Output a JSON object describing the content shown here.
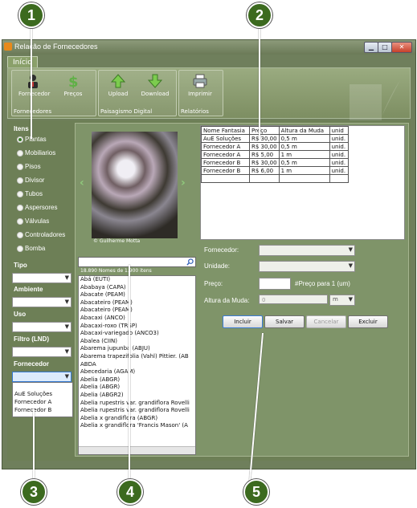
{
  "window": {
    "title": "Relação de Fornecedores",
    "minimize": "▁",
    "maximize": "□",
    "close": "✕"
  },
  "ribbon": {
    "tab": "Início",
    "groups": [
      {
        "label": "Fornecedores",
        "buttons": [
          "Fornecedor",
          "Preços"
        ]
      },
      {
        "label": "Paisagismo Digital",
        "buttons": [
          "Upload",
          "Download"
        ]
      },
      {
        "label": "Relatórios",
        "buttons": [
          "Imprimir"
        ]
      }
    ]
  },
  "sidebar": {
    "itens_label": "Itens",
    "itens": [
      "Plantas",
      "Mobiliarios",
      "Pisos",
      "Divisor",
      "Tubos",
      "Aspersores",
      "Válvulas",
      "Controladores",
      "Bomba"
    ],
    "selected_item": "Plantas",
    "filters": [
      {
        "label": "Tipo"
      },
      {
        "label": "Ambiente"
      },
      {
        "label": "Uso"
      },
      {
        "label": "Filtro (LND)"
      },
      {
        "label": "Fornecedor"
      }
    ],
    "fornecedor_options": [
      "AuE Soluções",
      "Fornecedor A",
      "Fornecedor B"
    ]
  },
  "photo": {
    "credit": "© Guilherme Motta",
    "prev": "‹",
    "next": "›"
  },
  "search": {
    "count": "18.890 Nomes de 1.900 itens",
    "icon": "search-icon"
  },
  "plant_list": [
    "Abá (EUTI)",
    "Ababaya (CAPA)",
    "Abacate (PEAM)",
    "Abacateiro (PEAM)",
    "Abacateiro (PEAM)",
    "Abacaxi (ANCO)",
    "Abacaxi-roxo (TRSP)",
    "Abacaxi-variegado (ANCO3)",
    "Abalea (CIIN)",
    "Abarema jupunba (ABJU)",
    "Abarema trapezifolia (Vahl) Pittier. (AB",
    "ABDA",
    "Abecedaria (AGAM)",
    "Abelia (ABGR)",
    "Abelia (ABGR)",
    "Abelia (ABGR2)",
    "Abelia rupestris var. grandiflora Rovelli",
    "Abelia rupestris var. grandiflora Rovelli",
    "Abelia x grandiflora (ABGR)",
    "Abelia x grandiflora 'Francis Mason' (A"
  ],
  "table": {
    "headers": [
      "Nome Fantasia",
      "Preço",
      "Altura da Muda",
      "unid"
    ],
    "rows": [
      [
        "AuE Soluções",
        "R$ 30,00",
        "0,5 m",
        "unid."
      ],
      [
        "Fornecedor A",
        "R$ 30,00",
        "0,5 m",
        "unid."
      ],
      [
        "Fornecedor A",
        "R$ 5,00",
        "1 m",
        "unid."
      ],
      [
        "Fornecedor B",
        "R$ 30,00",
        "0,5 m",
        "unid."
      ],
      [
        "Fornecedor B",
        "R$ 6,00",
        "1 m",
        "unid."
      ]
    ]
  },
  "form": {
    "fornecedor_label": "Fornecedor:",
    "unidade_label": "Unidade:",
    "preco_label": "Preço:",
    "preco_hint": "#Preço para 1 (um)",
    "altura_label": "Altura da Muda:",
    "altura_value": "0",
    "altura_unit": "m"
  },
  "buttons": {
    "incluir": "Incluir",
    "salvar": "Salvar",
    "cancelar": "Cancelar",
    "excluir": "Excluir"
  },
  "callouts": [
    "1",
    "2",
    "3",
    "4",
    "5"
  ]
}
